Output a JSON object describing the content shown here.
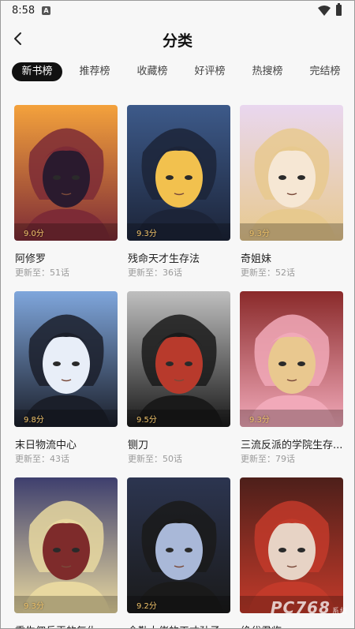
{
  "status_bar": {
    "time": "8:58",
    "notification_badge": "A"
  },
  "header": {
    "title": "分类"
  },
  "tabs": [
    {
      "label": "新书榜",
      "active": true
    },
    {
      "label": "推荐榜",
      "active": false
    },
    {
      "label": "收藏榜",
      "active": false
    },
    {
      "label": "好评榜",
      "active": false
    },
    {
      "label": "热搜榜",
      "active": false
    },
    {
      "label": "完结榜",
      "active": false
    }
  ],
  "books": [
    {
      "title": "阿修罗",
      "score": "9.0分",
      "update": "更新至：51话",
      "palette": [
        "#f4a23c",
        "#7d2b36",
        "#2a1a2e"
      ]
    },
    {
      "title": "残命天才生存法",
      "score": "9.3分",
      "update": "更新至：36话",
      "palette": [
        "#3d5a8a",
        "#1c2438",
        "#f2c14e"
      ]
    },
    {
      "title": "奇姐妹",
      "score": "9.3分",
      "update": "更新至：52话",
      "palette": [
        "#e9d7ef",
        "#e7c98e",
        "#f6e7d4"
      ]
    },
    {
      "title": "末日物流中心",
      "score": "9.8分",
      "update": "更新至：43话",
      "palette": [
        "#7fa6dc",
        "#1b1f2a",
        "#e8eef8"
      ]
    },
    {
      "title": "铡刀",
      "score": "9.5分",
      "update": "更新至：50话",
      "palette": [
        "#bfbfbf",
        "#1a1a1a",
        "#b83a2c"
      ]
    },
    {
      "title": "三流反派的学院生存...",
      "score": "9.3分",
      "update": "更新至：79话",
      "palette": [
        "#8a2a2a",
        "#f1a9b9",
        "#e9c88f"
      ]
    },
    {
      "title": "重生佣兵王的复仇",
      "score": "9.3分",
      "update": "",
      "palette": [
        "#3e3f6e",
        "#e8d8a0",
        "#7e2b2b"
      ]
    },
    {
      "title": "全勤大佬的天才孙子",
      "score": "9.2分",
      "update": "",
      "palette": [
        "#2c3550",
        "#1a1a1a",
        "#a9b8d8"
      ]
    },
    {
      "title": "绝代君临",
      "score": "",
      "update": "",
      "palette": [
        "#4d1f1a",
        "#c23a2a",
        "#e7d3c5"
      ]
    }
  ],
  "watermark": {
    "text": "PC768",
    "suffix": "系统"
  }
}
